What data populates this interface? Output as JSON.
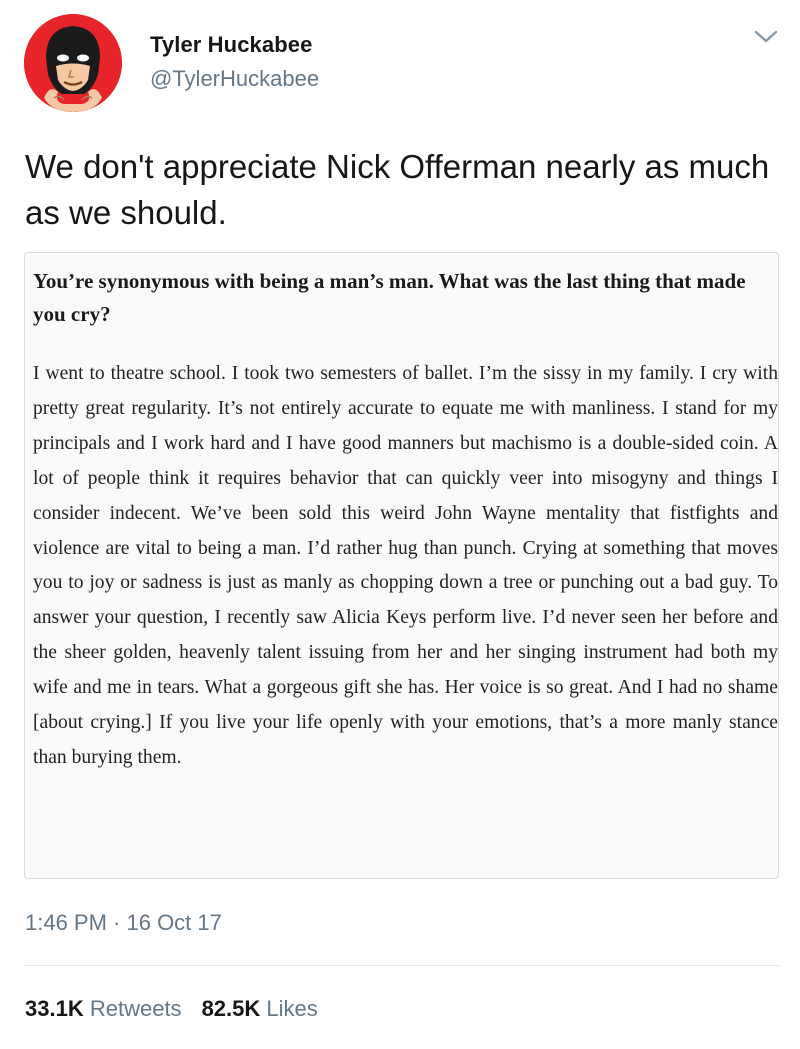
{
  "author": {
    "name": "Tyler Huckabee",
    "handle": "@TylerHuckabee",
    "avatar_icon": "masked-hero-avatar-icon",
    "avatar_color": "#e8242b"
  },
  "tweet": {
    "text": "We don't appreciate Nick Offerman nearly as much as we should."
  },
  "quoted_image": {
    "question": "You’re synonymous with being a man’s man. What was the last thing that made you cry?",
    "answer": "I went to theatre school. I took two semesters of ballet. I’m the sissy in my family. I cry with pretty great regularity. It’s not entirely accurate to equate me with manliness. I stand for my principals and I work hard and I have good manners but machismo is a double-sided coin. A lot of people think it requires behavior that can quickly veer into misogyny and things I consider indecent. We’ve been sold this weird John Wayne mentality that fistfights and violence are vital to being a man. I’d rather hug than punch. Crying at something that moves you to joy or sadness is just as manly as chopping down a tree or punching out a bad guy. To answer your question, I recently saw Alicia Keys perform live. I’d never seen her before and the sheer golden, heavenly talent issuing from her and her singing instrument had both my wife and me in tears. What a gorgeous gift she has. Her voice is so great. And I had no shame [about crying.] If you live your life openly with your emotions, that’s a more manly stance than burying them."
  },
  "meta": {
    "timestamp": "1:46 PM · 16 Oct 17"
  },
  "stats": {
    "retweets_count": "33.1K",
    "retweets_label": "Retweets",
    "likes_count": "82.5K",
    "likes_label": "Likes"
  },
  "icons": {
    "menu": "chevron-down-icon"
  }
}
